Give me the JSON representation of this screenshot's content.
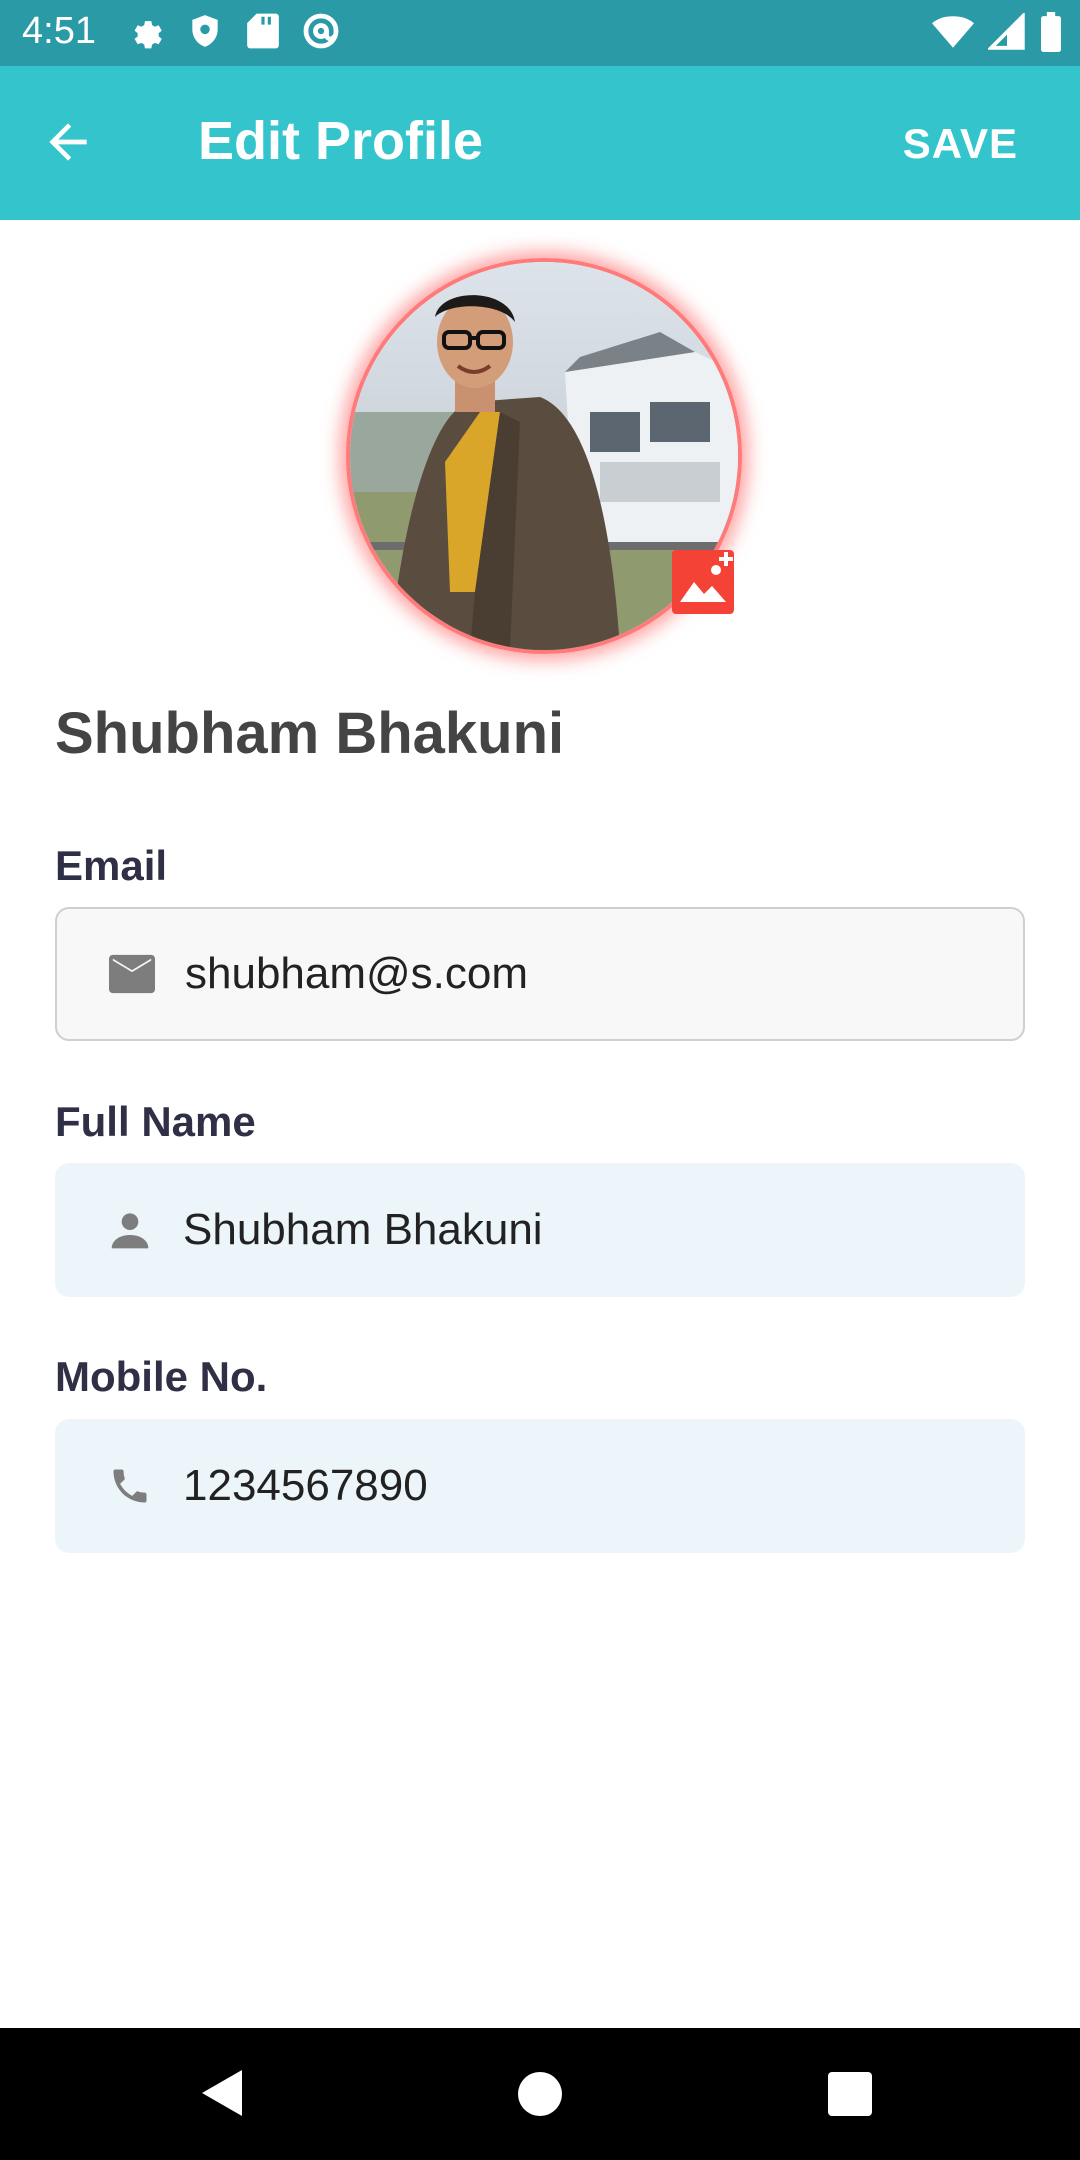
{
  "status_bar": {
    "time": "4:51",
    "left_icons": [
      "settings-icon",
      "shield-icon",
      "sd-card-icon",
      "at-sign-icon"
    ],
    "right_icons": [
      "wifi-icon",
      "signal-icon",
      "battery-icon"
    ]
  },
  "app_bar": {
    "title": "Edit Profile",
    "save_label": "SAVE",
    "back_icon": "arrow-left-icon",
    "color": "#34c4cc"
  },
  "profile": {
    "name": "Shubham Bhakuni",
    "avatar_badge_icon": "image-add-icon",
    "badge_color": "#f44336"
  },
  "fields": {
    "email": {
      "label": "Email",
      "value": "shubham@s.com",
      "icon": "mail-icon"
    },
    "full_name": {
      "label": "Full Name",
      "value": "Shubham Bhakuni",
      "icon": "person-icon"
    },
    "mobile": {
      "label": "Mobile No.",
      "value": "1234567890",
      "icon": "phone-icon"
    }
  },
  "nav_bar": {
    "buttons": [
      "back-triangle-icon",
      "home-circle-icon",
      "recents-square-icon"
    ]
  }
}
